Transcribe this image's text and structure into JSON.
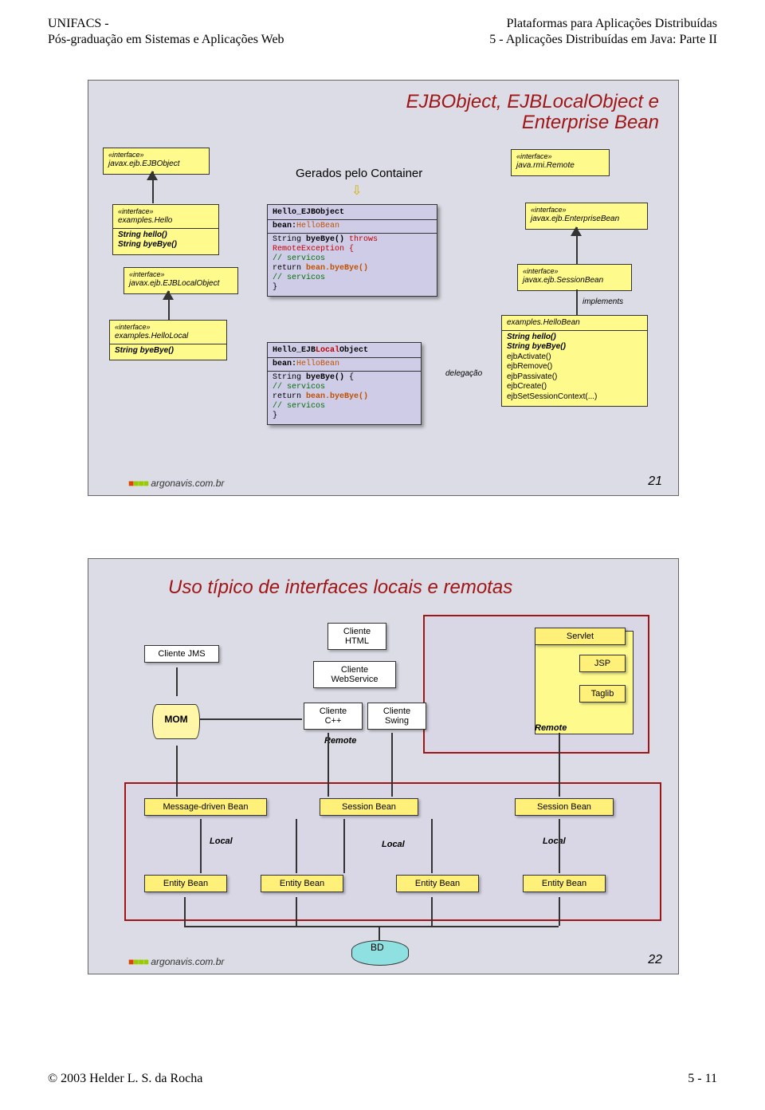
{
  "header": {
    "left1": "UNIFACS -",
    "left2": "Pós-graduação em Sistemas e Aplicações Web",
    "right1": "Plataformas para Aplicações Distribuídas",
    "right2": "5 - Aplicações Distribuídas em Java: Parte II"
  },
  "footer": {
    "left": "© 2003 Helder L. S. da Rocha",
    "right": "5 - 11"
  },
  "badge": "argonavis.com.br",
  "slide1": {
    "title1": "EJBObject, EJBLocalObject e",
    "title2": "Enterprise Bean",
    "num": "21",
    "gerados": "Gerados pelo Container",
    "interfaces": {
      "ejbobject": {
        "s": "«interface»",
        "n": "javax.ejb.EJBObject"
      },
      "hello": {
        "s": "«interface»",
        "n": "examples.Hello",
        "m1": "String hello()",
        "m2": "String byeBye()"
      },
      "localobj": {
        "s": "«interface»",
        "n": "javax.ejb.EJBLocalObject"
      },
      "hellolocal": {
        "s": "«interface»",
        "n": "examples.HelloLocal",
        "m1": "String byeBye()"
      },
      "rmiremote": {
        "s": "«interface»",
        "n": "java.rmi.Remote"
      },
      "entbean": {
        "s": "«interface»",
        "n": "javax.ejb.EnterpriseBean"
      },
      "sessbean": {
        "s": "«interface»",
        "n": "javax.ejb.SessionBean"
      }
    },
    "impl": {
      "implements": "implements",
      "cls": "examples.HelloBean",
      "m1": "String hello()",
      "m2": "String byeBye()",
      "m3": "ejbActivate()",
      "m4": "ejbRemove()",
      "m5": "ejbPassivate()",
      "m6": "ejbCreate()",
      "m7": "ejbSetSessionContext(...)"
    },
    "deleg": "delegação",
    "code1": {
      "l1": "Hello_EJBObject",
      "l2a": "bean:",
      "l2b": "HelloBean",
      "l3a": "String ",
      "l3b": "byeBye()",
      "l3c": " throws",
      "l4": "          RemoteException {",
      "l5": "  // servicos",
      "l6a": "  return ",
      "l6b": "bean.byeBye()",
      "l7": "  // servicos",
      "l8": "}"
    },
    "code2": {
      "l1a": "Hello_EJB",
      "l1b": "Local",
      "l1c": "Object",
      "l2a": "bean:",
      "l2b": "HelloBean",
      "l3a": "String ",
      "l3b": "byeBye()",
      "l3c": " {",
      "l4": "  // servicos",
      "l5a": "  return ",
      "l5b": "bean.byeBye()",
      "l6": "  // servicos",
      "l7": "}"
    }
  },
  "slide2": {
    "title": "Uso típico de interfaces locais e remotas",
    "num": "22",
    "nodes": {
      "jms": "Cliente JMS",
      "mom": "MOM",
      "html1": "Cliente",
      "html2": "HTML",
      "ws1": "Cliente",
      "ws2": "WebService",
      "cpp1": "Cliente",
      "cpp2": "C++",
      "swing1": "Cliente",
      "swing2": "Swing",
      "servlet": "Servlet",
      "jsp": "JSP",
      "taglib": "Taglib",
      "mdb": "Message-driven Bean",
      "sess": "Session Bean",
      "ent": "Entity Bean",
      "bd": "BD",
      "remote": "Remote",
      "local": "Local"
    }
  }
}
